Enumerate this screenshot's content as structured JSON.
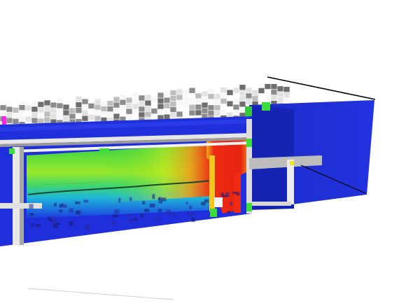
{
  "scene": {
    "background": "#ffffff",
    "colors": {
      "slice_blue": "#1f2fdc",
      "slice_blue_dark": "#1822b8",
      "field_green": "#3ddc3a",
      "field_yellow": "#d8e81a",
      "field_red": "#ee2a14",
      "voxel_grey": "#8c8c8c",
      "voxel_light": "#e2e2e2",
      "voxel_white": "#f7f7f7",
      "edge_black": "#000000",
      "marker_magenta": "#ff22ee"
    },
    "elements": [
      "voxel-roof",
      "simulation-slice",
      "temperature-gradient-field",
      "hot-plume",
      "structural-beams",
      "side-wall",
      "bounding-box-edges"
    ]
  }
}
